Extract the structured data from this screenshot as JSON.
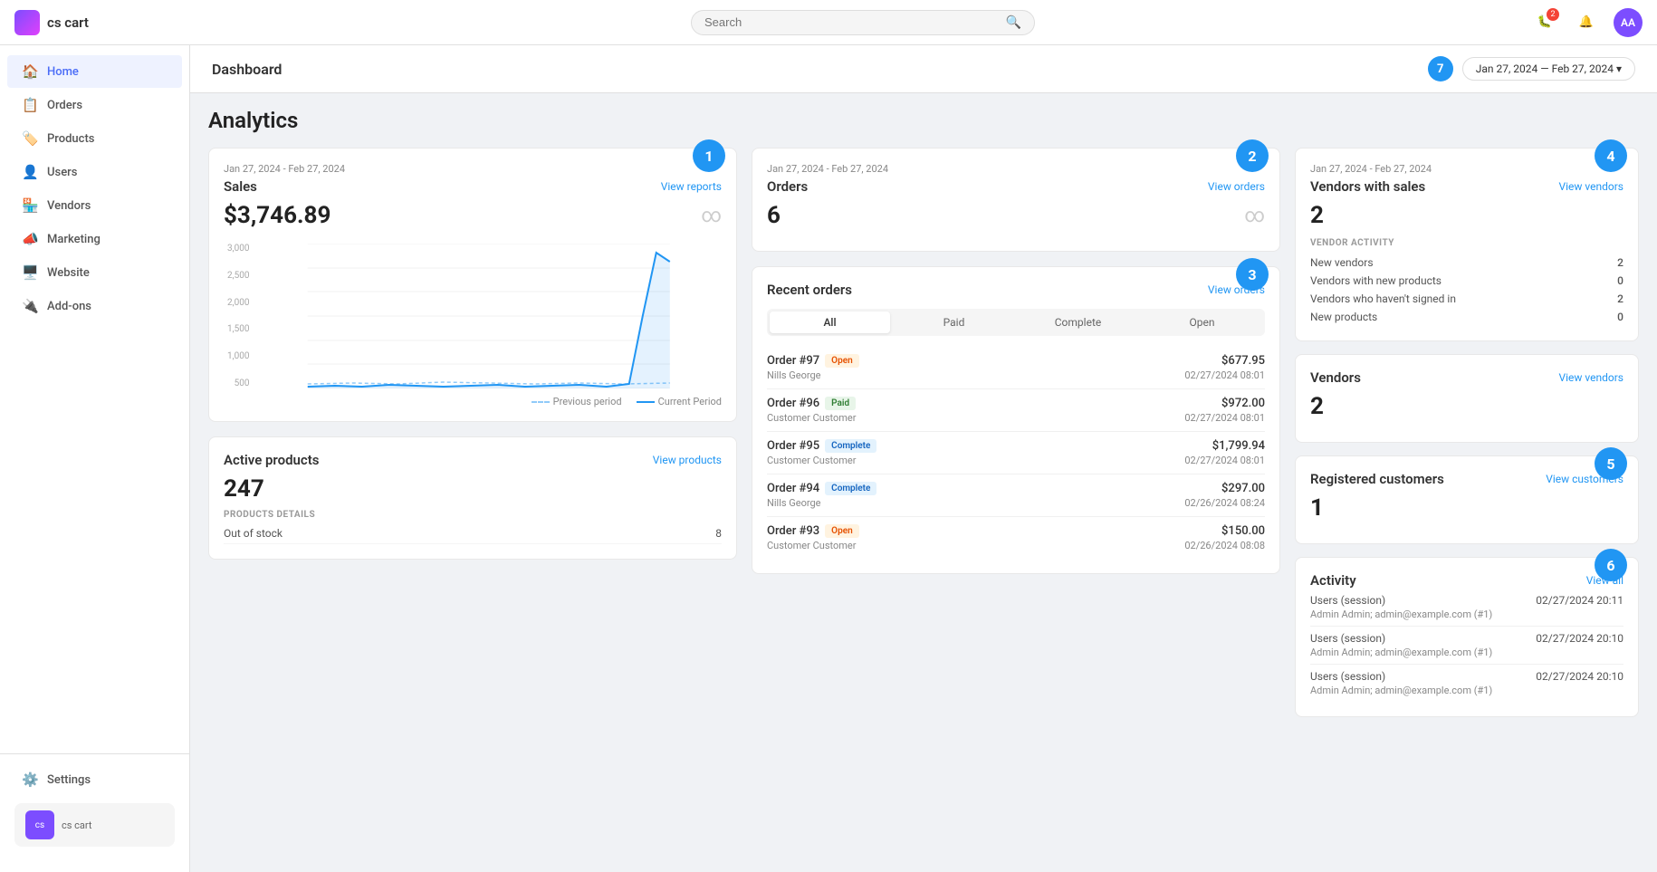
{
  "app": {
    "logo_text": "cs cart"
  },
  "topbar": {
    "search_placeholder": "Search",
    "notifications_count": "2",
    "avatar_initials": "AA",
    "date_range": "Jan 27, 2024 — Feb 27, 2024 ▾",
    "period_number": "7"
  },
  "sidebar": {
    "items": [
      {
        "id": "home",
        "label": "Home",
        "icon": "🏠",
        "active": true
      },
      {
        "id": "orders",
        "label": "Orders",
        "icon": "📋",
        "active": false
      },
      {
        "id": "products",
        "label": "Products",
        "icon": "🏷️",
        "active": false
      },
      {
        "id": "users",
        "label": "Users",
        "icon": "👤",
        "active": false
      },
      {
        "id": "vendors",
        "label": "Vendors",
        "icon": "🏪",
        "active": false
      },
      {
        "id": "marketing",
        "label": "Marketing",
        "icon": "📣",
        "active": false
      },
      {
        "id": "website",
        "label": "Website",
        "icon": "🖥️",
        "active": false
      },
      {
        "id": "addons",
        "label": "Add-ons",
        "icon": "🔌",
        "active": false
      }
    ],
    "settings_label": "Settings",
    "store_name": "cs cart"
  },
  "dashboard": {
    "title": "Dashboard",
    "analytics_title": "Analytics"
  },
  "sales_card": {
    "badge": "1",
    "date_range": "Jan 27, 2024 - Feb 27, 2024",
    "title": "Sales",
    "link": "View reports",
    "value": "$3,746.89",
    "chart": {
      "y_labels": [
        "3,000",
        "2,500",
        "2,000",
        "1,500",
        "1,000",
        "500"
      ],
      "legend_prev": "Previous period",
      "legend_curr": "Current Period"
    }
  },
  "orders_card": {
    "badge": "2",
    "date_range": "Jan 27, 2024 - Feb 27, 2024",
    "title": "Orders",
    "link": "View orders",
    "value": "6"
  },
  "recent_orders": {
    "badge": "3",
    "title": "Recent orders",
    "link": "View orders",
    "tabs": [
      "All",
      "Paid",
      "Complete",
      "Open"
    ],
    "active_tab": "All",
    "orders": [
      {
        "id": "Order #97",
        "status": "Open",
        "status_class": "open",
        "customer": "Nills George",
        "amount": "$677.95",
        "date": "02/27/2024 08:01"
      },
      {
        "id": "Order #96",
        "status": "Paid",
        "status_class": "paid",
        "customer": "Customer Customer",
        "amount": "$972.00",
        "date": "02/27/2024 08:01"
      },
      {
        "id": "Order #95",
        "status": "Complete",
        "status_class": "complete",
        "customer": "Customer Customer",
        "amount": "$1,799.94",
        "date": "02/27/2024 08:01"
      },
      {
        "id": "Order #94",
        "status": "Complete",
        "status_class": "complete",
        "customer": "Nills George",
        "amount": "$297.00",
        "date": "02/26/2024 08:24"
      },
      {
        "id": "Order #93",
        "status": "Open",
        "status_class": "open",
        "customer": "Customer Customer",
        "amount": "$150.00",
        "date": "02/26/2024 08:08"
      }
    ]
  },
  "active_products": {
    "title": "Active products",
    "link": "View products",
    "value": "247",
    "details_title": "PRODUCTS DETAILS",
    "details": [
      {
        "label": "Out of stock",
        "value": "8"
      }
    ]
  },
  "vendors_with_sales": {
    "badge": "4",
    "date_range": "Jan 27, 2024 - Feb 27, 2024",
    "title": "Vendors with sales",
    "link": "View vendors",
    "value": "2",
    "activity_title": "VENDOR ACTIVITY",
    "activity_rows": [
      {
        "label": "New vendors",
        "value": "2"
      },
      {
        "label": "Vendors with new products",
        "value": "0"
      },
      {
        "label": "Vendors who haven't signed in",
        "value": "2"
      },
      {
        "label": "New products",
        "value": "0"
      }
    ]
  },
  "vendors": {
    "title": "Vendors",
    "link": "View vendors",
    "value": "2"
  },
  "registered_customers": {
    "badge": "5",
    "title": "Registered customers",
    "link": "View customers",
    "value": "1"
  },
  "activity": {
    "badge": "6",
    "title": "Activity",
    "link": "View all",
    "rows": [
      {
        "type": "Users (session)",
        "date": "02/27/2024 20:11",
        "detail": "Admin Admin; admin@example.com (#1)"
      },
      {
        "type": "Users (session)",
        "date": "02/27/2024 20:10",
        "detail": "Admin Admin; admin@example.com (#1)"
      },
      {
        "type": "Users (session)",
        "date": "02/27/2024 20:10",
        "detail": "Admin Admin; admin@example.com (#1)"
      }
    ]
  }
}
